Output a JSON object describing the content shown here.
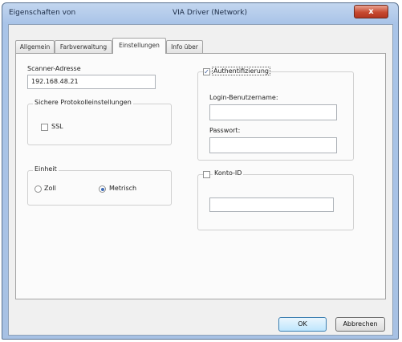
{
  "window": {
    "title_left": "Eigenschaften von",
    "title_center": "VIA Driver (Network)",
    "close_label": "x"
  },
  "tabs": [
    {
      "label": "Allgemein"
    },
    {
      "label": "Farbverwaltung"
    },
    {
      "label": "Einstellungen"
    },
    {
      "label": "Info über"
    }
  ],
  "settings": {
    "scanner_address_label": "Scanner-Adresse",
    "scanner_address_value": "192.168.48.21",
    "secure_group_title": "Sichere Protokolleinstellungen",
    "ssl_label": "SSL",
    "ssl_checked": false,
    "unit_group_title": "Einheit",
    "unit_options": [
      {
        "label": "Zoll",
        "selected": false
      },
      {
        "label": "Metrisch",
        "selected": true
      }
    ],
    "auth_label": "Authentifizierung",
    "auth_checked": true,
    "login_label": "Login-Benutzername:",
    "login_value": "",
    "password_label": "Passwort:",
    "password_value": "",
    "account_id_label": "Konto-ID",
    "account_id_checked": false,
    "account_id_value": ""
  },
  "buttons": {
    "ok": "OK",
    "cancel": "Abbrechen"
  }
}
